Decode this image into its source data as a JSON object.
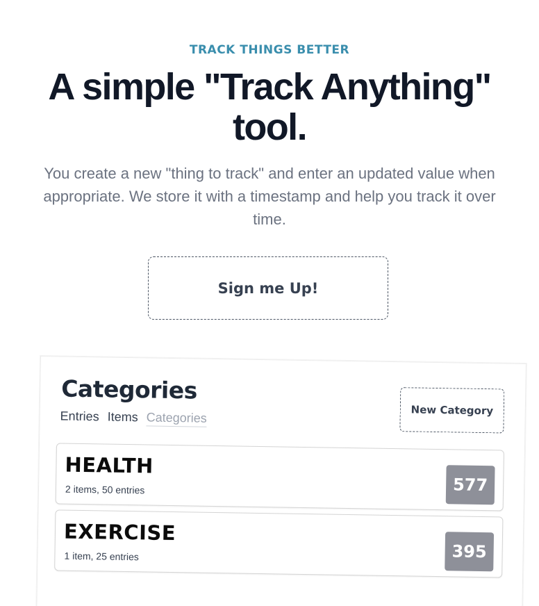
{
  "hero": {
    "eyebrow": "TRACK THINGS BETTER",
    "headline": "A simple \"Track Anything\" tool.",
    "description": "You create a new \"thing to track\" and enter an updated value when appropriate. We store it with a timestamp and help you track it over time.",
    "signup_label": "Sign me Up!",
    "accent_color": "#3a8ead"
  },
  "mockup": {
    "page_title": "Categories",
    "nav": [
      {
        "label": "Entries",
        "active": false
      },
      {
        "label": "Items",
        "active": false
      },
      {
        "label": "Categories",
        "active": true
      }
    ],
    "new_category_label": "New Category",
    "categories": [
      {
        "name": "HEALTH",
        "meta": "2 items, 50 entries",
        "count": "577"
      },
      {
        "name": "EXERCISE",
        "meta": "1 item, 25 entries",
        "count": "395"
      }
    ]
  }
}
